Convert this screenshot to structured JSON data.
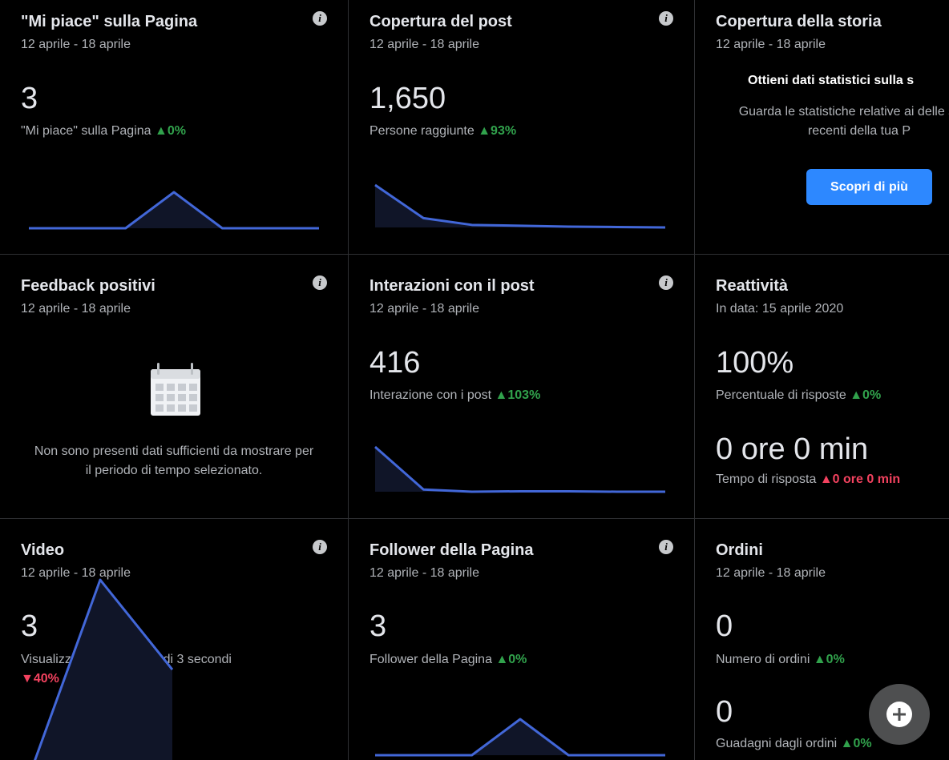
{
  "info_glyph": "i",
  "colors": {
    "accent": "#4267d8",
    "positive": "#31a24c",
    "negative": "#f3425f",
    "button": "#2d88ff"
  },
  "cards": {
    "page_likes": {
      "title": "\"Mi piace\" sulla Pagina",
      "date": "12 aprile - 18 aprile",
      "value": "3",
      "label": "\"Mi piace\" sulla Pagina",
      "change": "▲0%",
      "sparkline": [
        0,
        0,
        0,
        1,
        0,
        0,
        0
      ]
    },
    "post_reach": {
      "title": "Copertura del post",
      "date": "12 aprile - 18 aprile",
      "value": "1,650",
      "label": "Persone raggiunte",
      "change": "▲93%",
      "sparkline": [
        1,
        0.22,
        0.06,
        0.04,
        0.02,
        0.01,
        0
      ]
    },
    "story_reach": {
      "title": "Copertura della storia",
      "date": "12 aprile - 18 aprile",
      "heading": "Ottieni dati statistici sulla s",
      "body": "Guarda le statistiche relative ai delle storie recenti della tua P",
      "button": "Scopri di più"
    },
    "positive_feedback": {
      "title": "Feedback positivi",
      "date": "12 aprile - 18 aprile",
      "empty_message": "Non sono presenti dati sufficienti da mostrare per il periodo di tempo selezionato."
    },
    "post_engagement": {
      "title": "Interazioni con il post",
      "date": "12 aprile - 18 aprile",
      "value": "416",
      "label": "Interazione con i post",
      "change": "▲103%",
      "sparkline": [
        1,
        0.05,
        0,
        0.01,
        0.01,
        0,
        0
      ]
    },
    "responsiveness": {
      "title": "Reattività",
      "date": "In data: 15 aprile 2020",
      "value": "100%",
      "label": "Percentuale di risposte",
      "change": "▲0%",
      "value2": "0 ore 0 min",
      "label2": "Tempo di risposta",
      "change2": "▲0 ore 0 min"
    },
    "video": {
      "title": "Video",
      "date": "12 aprile - 18 aprile",
      "value": "3",
      "label": "Visualizzazioni del video di 3 secondi",
      "change": "▼40%",
      "sparkline": [
        0,
        1,
        0.55
      ]
    },
    "page_followers": {
      "title": "Follower della Pagina",
      "date": "12 aprile - 18 aprile",
      "value": "3",
      "label": "Follower della Pagina",
      "change": "▲0%",
      "sparkline": [
        0,
        0,
        0,
        1,
        0,
        0,
        0
      ]
    },
    "orders": {
      "title": "Ordini",
      "date": "12 aprile - 18 aprile",
      "value": "0",
      "label": "Numero di ordini",
      "change": "▲0%",
      "value2": "0",
      "label2": "Guadagni dagli ordini",
      "change2": "▲0%"
    }
  }
}
